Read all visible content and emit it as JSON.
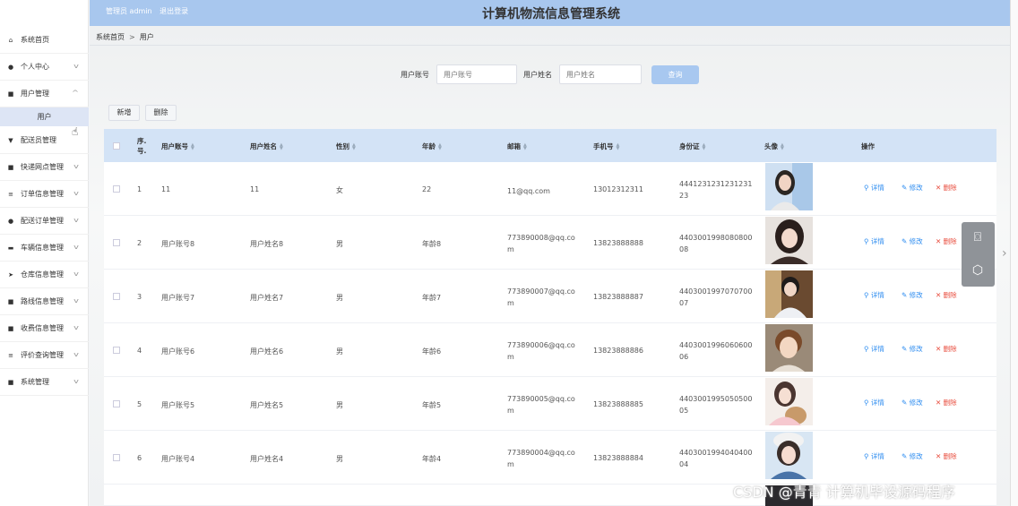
{
  "header": {
    "admin_label": "管理员 admin",
    "logout_label": "退出登录",
    "title": "计算机物流信息管理系统"
  },
  "breadcrumb": {
    "home": "系统首页",
    "separator": ">",
    "current": "用户"
  },
  "sidebar": {
    "items": [
      {
        "label": "系统首页",
        "icon": "home-icon"
      },
      {
        "label": "个人中心",
        "icon": "user-icon"
      },
      {
        "label": "用户管理",
        "icon": "grid-icon"
      },
      {
        "label": "配送员管理",
        "icon": "trophy-icon"
      },
      {
        "label": "快递网点管理",
        "icon": "grid-icon"
      },
      {
        "label": "订单信息管理",
        "icon": "list-icon"
      },
      {
        "label": "配送订单管理",
        "icon": "user-icon"
      },
      {
        "label": "车辆信息管理",
        "icon": "car-icon"
      },
      {
        "label": "仓库信息管理",
        "icon": "send-icon"
      },
      {
        "label": "路线信息管理",
        "icon": "grid-icon"
      },
      {
        "label": "收费信息管理",
        "icon": "grid-icon"
      },
      {
        "label": "评价查询管理",
        "icon": "list-icon"
      },
      {
        "label": "系统管理",
        "icon": "grid-icon"
      }
    ],
    "sub_item": "用户"
  },
  "search": {
    "account_label": "用户账号",
    "account_placeholder": "用户账号",
    "name_label": "用户姓名",
    "name_placeholder": "用户姓名",
    "query_button": "查询"
  },
  "toolbar": {
    "add": "新增",
    "delete": "删除"
  },
  "table": {
    "headers": {
      "index_1": "序.",
      "index_2": "号.",
      "account": "用户账号",
      "name": "用户姓名",
      "gender": "性别",
      "age": "年龄",
      "email": "邮箱",
      "phone": "手机号",
      "idcard": "身份证",
      "avatar": "头像",
      "actions": "操作"
    },
    "rows": [
      {
        "no": "1",
        "account": "11",
        "name": "11",
        "gender": "女",
        "age": "22",
        "email_1": "11@qq.com",
        "email_2": "",
        "phone": "13012312311",
        "id_1": "4441231231231231",
        "id_2": "23"
      },
      {
        "no": "2",
        "account": "用户账号8",
        "name": "用户姓名8",
        "gender": "男",
        "age": "年龄8",
        "email_1": "773890008@qq.co",
        "email_2": "m",
        "phone": "13823888888",
        "id_1": "4403001998080800",
        "id_2": "08"
      },
      {
        "no": "3",
        "account": "用户账号7",
        "name": "用户姓名7",
        "gender": "男",
        "age": "年龄7",
        "email_1": "773890007@qq.co",
        "email_2": "m",
        "phone": "13823888887",
        "id_1": "4403001997070700",
        "id_2": "07"
      },
      {
        "no": "4",
        "account": "用户账号6",
        "name": "用户姓名6",
        "gender": "男",
        "age": "年龄6",
        "email_1": "773890006@qq.co",
        "email_2": "m",
        "phone": "13823888886",
        "id_1": "4403001996060600",
        "id_2": "06"
      },
      {
        "no": "5",
        "account": "用户账号5",
        "name": "用户姓名5",
        "gender": "男",
        "age": "年龄5",
        "email_1": "773890005@qq.co",
        "email_2": "m",
        "phone": "13823888885",
        "id_1": "4403001995050500",
        "id_2": "05"
      },
      {
        "no": "6",
        "account": "用户账号4",
        "name": "用户姓名4",
        "gender": "男",
        "age": "年龄4",
        "email_1": "773890004@qq.co",
        "email_2": "m",
        "phone": "13823888884",
        "id_1": "4403001994040400",
        "id_2": "04"
      }
    ],
    "actions": {
      "detail": "详情",
      "edit": "修改",
      "delete": "删除"
    }
  },
  "watermark": "CSDN @青青  计算机毕设源码程序",
  "colors": {
    "header_bg": "#a8c7ee",
    "table_header_bg": "#d3e3f6",
    "link_blue": "#2d8cf0",
    "danger_red": "#e84c3d"
  }
}
